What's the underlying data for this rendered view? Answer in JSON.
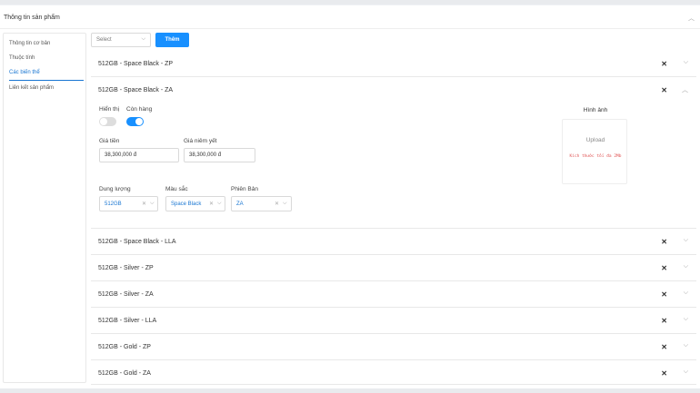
{
  "card": {
    "title": "Thông tin sản phẩm",
    "collapse_icon": "chevron-up-icon"
  },
  "sidenav": {
    "items": [
      {
        "label": "Thông tin cơ bản"
      },
      {
        "label": "Thuộc tính"
      },
      {
        "label": "Các biến thể",
        "active": true
      },
      {
        "label": "Liên kết sản phẩm"
      }
    ]
  },
  "toolbar": {
    "select_placeholder": "Select",
    "add_label": "Thêm"
  },
  "variants": [
    {
      "title": "512GB - Space Black - ZP",
      "expanded": false
    },
    {
      "title": "512GB - Space Black - ZA",
      "expanded": true
    },
    {
      "title": "512GB - Space Black - LLA",
      "expanded": false
    },
    {
      "title": "512GB - Silver - ZP",
      "expanded": false
    },
    {
      "title": "512GB - Silver - ZA",
      "expanded": false
    },
    {
      "title": "512GB - Silver - LLA",
      "expanded": false
    },
    {
      "title": "512GB - Gold - ZP",
      "expanded": false
    },
    {
      "title": "512GB - Gold - ZA",
      "expanded": false
    }
  ],
  "detail": {
    "show_label": "Hiển thị",
    "show_on": false,
    "stock_label": "Còn hàng",
    "stock_on": true,
    "price_label": "Giá tiền",
    "price_value": "38,300,000 đ",
    "list_price_label": "Giá niêm yết",
    "list_price_value": "38,300,000 đ",
    "capacity_label": "Dung lượng",
    "capacity_value": "512GB",
    "color_label": "Màu sắc",
    "color_value": "Space Black",
    "version_label": "Phiên Bản",
    "version_value": "ZA",
    "image_label": "Hình ảnh",
    "upload_label": "Upload",
    "upload_hint": "Kích thước tối đa 2Mb"
  },
  "colors": {
    "accent": "#1890ff",
    "link": "#1976d2",
    "hint": "#e05555"
  }
}
